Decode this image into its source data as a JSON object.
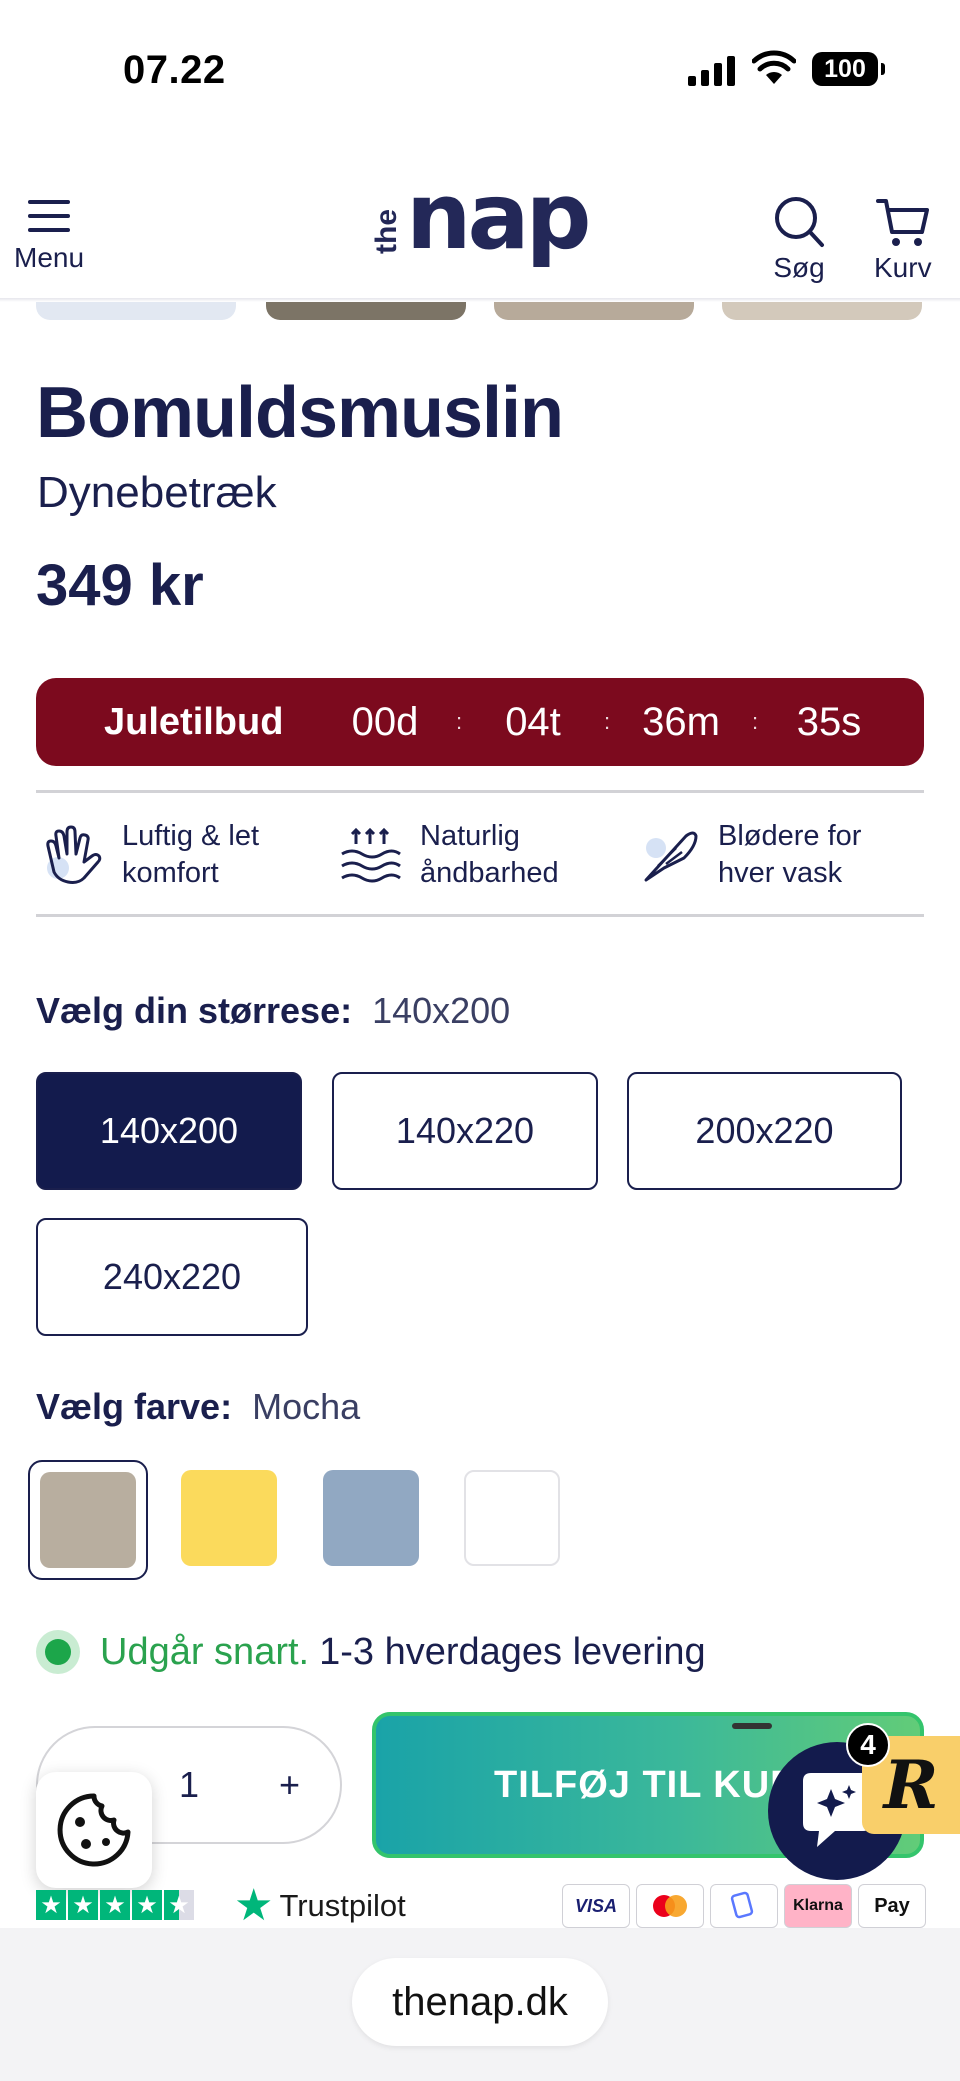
{
  "status_bar": {
    "time": "07.22",
    "battery": "100"
  },
  "header": {
    "menu_label": "Menu",
    "search_label": "Søg",
    "cart_label": "Kurv",
    "logo_the": "the",
    "logo_nap": "nap"
  },
  "product": {
    "title": "Bomuldsmuslin",
    "subtitle": "Dynebetræk",
    "price": "349 kr"
  },
  "countdown": {
    "label": "Juletilbud",
    "days": "00d",
    "hours": "04t",
    "minutes": "36m",
    "seconds": "35s",
    "color": "#7c0a1e"
  },
  "features": [
    {
      "icon": "hand-icon",
      "text": "Luftig & let komfort"
    },
    {
      "icon": "airflow-icon",
      "text": "Naturlig åndbarhed"
    },
    {
      "icon": "feather-icon",
      "text": "Blødere for hver vask"
    }
  ],
  "size": {
    "label": "Vælg din størrese:",
    "selected": "140x200",
    "options": [
      "140x200",
      "140x220",
      "200x220",
      "240x220"
    ]
  },
  "color": {
    "label": "Vælg farve:",
    "selected": "Mocha",
    "swatches": [
      "#b8ae9f",
      "#fbda5c",
      "#91a8c2",
      "#ffffff"
    ]
  },
  "stock": {
    "status": "Udgår snart.",
    "delivery": "1-3 hverdages levering"
  },
  "cart": {
    "quantity": "1",
    "minus": "−",
    "plus": "+",
    "add_label": "TILFØJ TIL KURV"
  },
  "chat": {
    "badge": "4",
    "brand_letter": "R"
  },
  "trust": {
    "label": "Trustpilot"
  },
  "payments": [
    "VISA",
    "MC",
    "MP",
    "Klarna",
    "Pay"
  ],
  "browser": {
    "url": "thenap.dk"
  }
}
